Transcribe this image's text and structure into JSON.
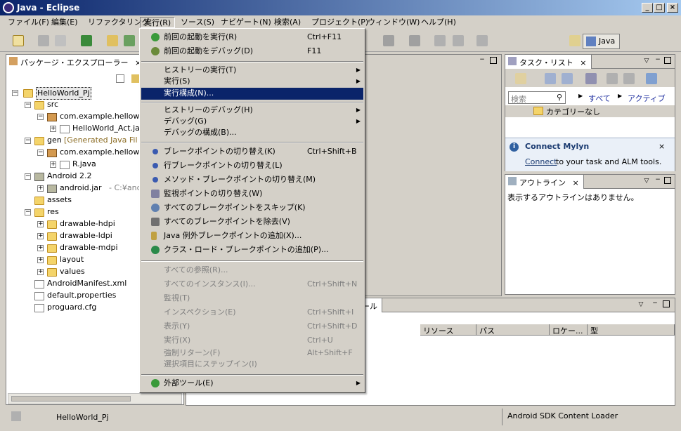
{
  "window": {
    "title": "Java - Eclipse",
    "accent": "#0a246a"
  },
  "menubar": [
    "ファイル(F)",
    "編集(E)",
    "リファクタリング",
    "実行(R)",
    "ソース(S)",
    "ナビゲート(N)",
    "検索(A)",
    "プロジェクト(P)",
    "ウィンドウ(W)",
    "ヘルプ(H)"
  ],
  "perspective": {
    "label": "Java"
  },
  "package_explorer": {
    "tab": "パッケージ・エクスプローラー",
    "tree": [
      {
        "label": "HelloWorld_Pj",
        "icon": "project-icon"
      },
      {
        "label": "src",
        "icon": "src-folder-icon"
      },
      {
        "label": "com.example.hellowo",
        "icon": "package-icon"
      },
      {
        "label": "HelloWorld_Act.ja",
        "icon": "java-file-icon"
      },
      {
        "label": "gen",
        "suffix": "[Generated Java Fil",
        "icon": "src-folder-icon"
      },
      {
        "label": "com.example.hellowo",
        "icon": "package-icon"
      },
      {
        "label": "R.java",
        "icon": "java-file-icon"
      },
      {
        "label": "Android 2.2",
        "icon": "library-icon"
      },
      {
        "label": "android.jar",
        "suffix": "- C:¥andro",
        "icon": "jar-icon"
      },
      {
        "label": "assets",
        "icon": "folder-icon"
      },
      {
        "label": "res",
        "icon": "folder-icon"
      },
      {
        "label": "drawable-hdpi",
        "icon": "folder-icon"
      },
      {
        "label": "drawable-ldpi",
        "icon": "folder-icon"
      },
      {
        "label": "drawable-mdpi",
        "icon": "folder-icon"
      },
      {
        "label": "layout",
        "icon": "folder-icon"
      },
      {
        "label": "values",
        "icon": "folder-icon"
      },
      {
        "label": "AndroidManifest.xml",
        "icon": "xml-file-icon"
      },
      {
        "label": "default.properties",
        "icon": "file-icon"
      },
      {
        "label": "proguard.cfg",
        "icon": "file-icon"
      }
    ]
  },
  "run_menu": {
    "items": [
      {
        "label": "前回の起動を実行(R)",
        "accel": "Ctrl+F11"
      },
      {
        "label": "前回の起動をデバッグ(D)",
        "accel": "F11"
      },
      {
        "label": "ヒストリーの実行(T)"
      },
      {
        "label": "実行(S)"
      },
      {
        "label": "実行構成(N)..."
      },
      {
        "label": "ヒストリーのデバッグ(H)"
      },
      {
        "label": "デバッグ(G)"
      },
      {
        "label": "デバッグの構成(B)..."
      },
      {
        "label": "ブレークポイントの切り替え(K)",
        "accel": "Ctrl+Shift+B"
      },
      {
        "label": "行ブレークポイントの切り替え(L)"
      },
      {
        "label": "メソッド・ブレークポイントの切り替え(M)"
      },
      {
        "label": "監視ポイントの切り替え(W)"
      },
      {
        "label": "すべてのブレークポイントをスキップ(K)"
      },
      {
        "label": "すべてのブレークポイントを除去(V)"
      },
      {
        "label": "Java 例外ブレークポイントの追加(X)..."
      },
      {
        "label": "クラス・ロード・ブレークポイントの追加(P)..."
      },
      {
        "label": "すべての参照(R)..."
      },
      {
        "label": "すべてのインスタンス(I)...",
        "accel": "Ctrl+Shift+N"
      },
      {
        "label": "監視(T)"
      },
      {
        "label": "インスペクション(E)",
        "accel": "Ctrl+Shift+I"
      },
      {
        "label": "表示(Y)",
        "accel": "Ctrl+Shift+D"
      },
      {
        "label": "実行(X)",
        "accel": "Ctrl+U"
      },
      {
        "label": "強制リターン(F)",
        "accel": "Alt+Shift+F"
      },
      {
        "label": "選択項目にステップイン(I)"
      },
      {
        "label": "外部ツール(E)"
      }
    ]
  },
  "task_list": {
    "tab": "タスク・リスト",
    "search_placeholder": "検索",
    "filter_all": "すべて",
    "filter_active": "アクティブに...",
    "category": "カテゴリーなし",
    "mylyn_title": "Connect Mylyn",
    "mylyn_link": "Connect",
    "mylyn_text": " to your task and ALM tools."
  },
  "outline": {
    "tab": "アウトライン",
    "message": "表示するアウトラインはありません。"
  },
  "problems": {
    "tab_fragment": "ール",
    "columns": [
      "リソース",
      "パス",
      "ロケー...",
      "型"
    ]
  },
  "status": {
    "left": "HelloWorld_Pj",
    "right": "Android SDK Content Loader"
  }
}
